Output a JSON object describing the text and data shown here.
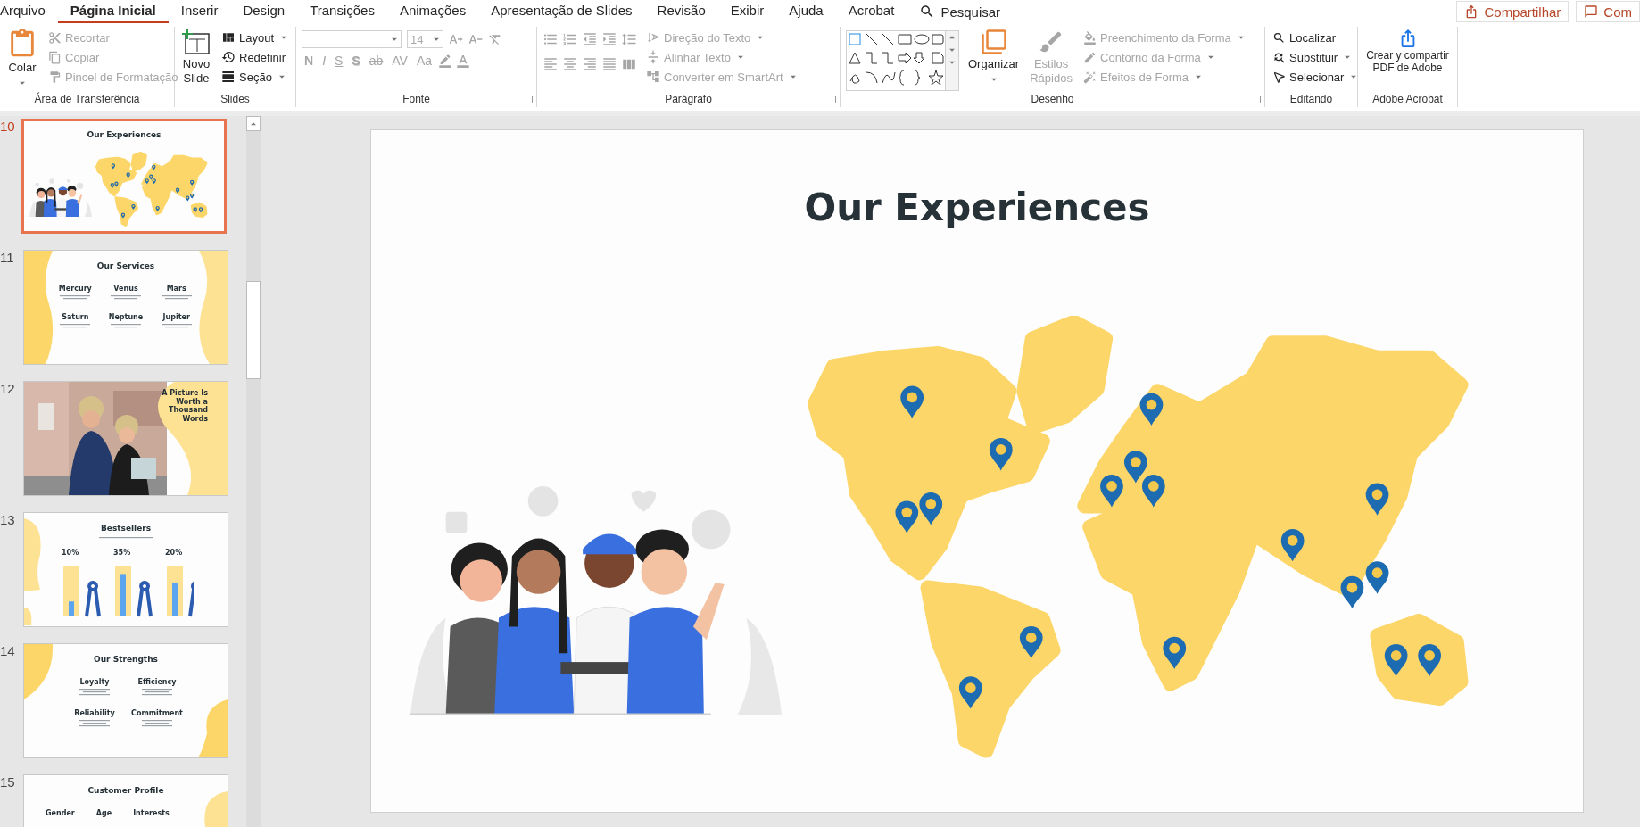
{
  "menu": {
    "tabs": [
      {
        "label": "Arquivo",
        "selected": false
      },
      {
        "label": "Página Inicial",
        "selected": true
      },
      {
        "label": "Inserir",
        "selected": false
      },
      {
        "label": "Design",
        "selected": false
      },
      {
        "label": "Transições",
        "selected": false
      },
      {
        "label": "Animações",
        "selected": false
      },
      {
        "label": "Apresentação de Slides",
        "selected": false
      },
      {
        "label": "Revisão",
        "selected": false
      },
      {
        "label": "Exibir",
        "selected": false
      },
      {
        "label": "Ajuda",
        "selected": false
      },
      {
        "label": "Acrobat",
        "selected": false
      }
    ],
    "search": "Pesquisar"
  },
  "header_buttons": [
    {
      "label": "Compartilhar",
      "kind": "share"
    },
    {
      "label": "Com",
      "kind": "comments"
    }
  ],
  "ribbon": {
    "clipboard": {
      "title": "Área de Transferência",
      "paste": "Colar",
      "items": [
        {
          "label": "Recortar",
          "kind": "cut",
          "disabled": true
        },
        {
          "label": "Copiar",
          "kind": "copy",
          "disabled": true
        },
        {
          "label": "Pincel de Formatação",
          "kind": "painter",
          "disabled": true
        }
      ]
    },
    "slides": {
      "title": "Slides",
      "new_slide": "Novo Slide",
      "items": [
        {
          "label": "Layout",
          "kind": "layout"
        },
        {
          "label": "Redefinir",
          "kind": "reset"
        },
        {
          "label": "Seção",
          "kind": "section"
        }
      ]
    },
    "font": {
      "title": "Fonte",
      "font_size": "14",
      "disabled": true,
      "format_buttons": [
        "N",
        "I",
        "S",
        "S",
        "ab",
        "AV",
        "Aa"
      ]
    },
    "paragraph": {
      "title": "Parágrafo",
      "items": [
        {
          "label": "Direção do Texto",
          "kind": "direction",
          "disabled": true
        },
        {
          "label": "Alinhar Texto",
          "kind": "align",
          "disabled": true
        },
        {
          "label": "Converter em SmartArt",
          "kind": "smartart",
          "disabled": true
        }
      ]
    },
    "drawing": {
      "title": "Desenho",
      "arrange": "Organizar",
      "quick_styles": "Estilos Rápidos",
      "quick_styles_disabled": true,
      "items": [
        {
          "label": "Preenchimento da Forma",
          "kind": "fill",
          "disabled": true
        },
        {
          "label": "Contorno da Forma",
          "kind": "outline",
          "disabled": true
        },
        {
          "label": "Efeitos de Forma",
          "kind": "effects",
          "disabled": true
        }
      ]
    },
    "editing": {
      "title": "Editando",
      "items": [
        {
          "label": "Localizar",
          "kind": "find"
        },
        {
          "label": "Substituir",
          "kind": "replace"
        },
        {
          "label": "Selecionar",
          "kind": "select"
        }
      ]
    },
    "acrobat": {
      "title": "Adobe Acrobat",
      "button": "Crear y compartir PDF de Adobe"
    }
  },
  "thumbnails": [
    {
      "number": "10",
      "selected": true,
      "kind": "map",
      "title": "Our Experiences"
    },
    {
      "number": "11",
      "selected": false,
      "kind": "services",
      "title": "Our Services",
      "items": [
        "Mercury",
        "Venus",
        "Mars",
        "Saturn",
        "Neptune",
        "Jupiter"
      ]
    },
    {
      "number": "12",
      "selected": false,
      "title": "A Picture Is Worth a Thousand Words"
    },
    {
      "number": "13",
      "selected": false,
      "kind": "bars",
      "title": "Bestsellers",
      "items": [
        "10%",
        "35%",
        "20%"
      ]
    },
    {
      "number": "14",
      "selected": false,
      "kind": "strengths",
      "title": "Our Strengths",
      "items": [
        "Loyalty",
        "Efficiency",
        "Reliability",
        "Commitment"
      ]
    },
    {
      "number": "15",
      "selected": false,
      "kind": "profile",
      "title": "Customer Profile",
      "items": [
        "Gender",
        "Age",
        "Interests"
      ]
    }
  ],
  "slide": {
    "title": "Our Experiences"
  }
}
